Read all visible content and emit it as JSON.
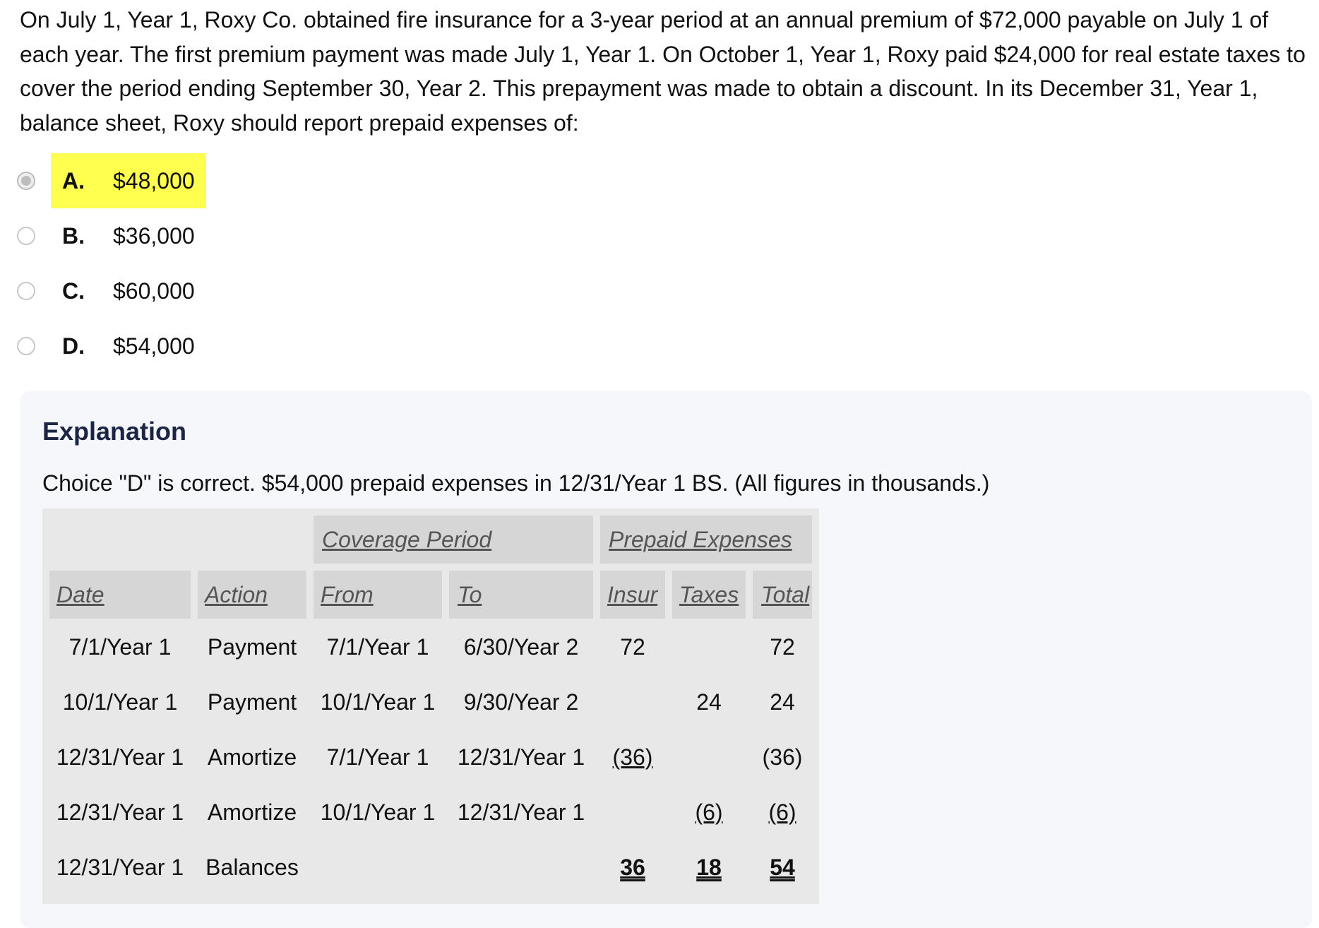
{
  "question": {
    "text": "On July 1, Year 1, Roxy Co. obtained fire insurance for a 3-year period at an annual premium of $72,000 payable on July 1 of each year. The first premium payment was made July 1, Year 1. On October 1, Year 1, Roxy paid $24,000 for real estate taxes to cover the period ending September 30, Year 2. This prepayment was made to obtain a discount. In its December 31, Year 1, balance sheet, Roxy should report prepaid expenses of:"
  },
  "choices": [
    {
      "letter": "A.",
      "value": "$48,000",
      "selected": true,
      "highlighted": true
    },
    {
      "letter": "B.",
      "value": "$36,000",
      "selected": false,
      "highlighted": false
    },
    {
      "letter": "C.",
      "value": "$60,000",
      "selected": false,
      "highlighted": false
    },
    {
      "letter": "D.",
      "value": "$54,000",
      "selected": false,
      "highlighted": false
    }
  ],
  "explanation": {
    "title": "Explanation",
    "text": "Choice \"D\" is correct. $54,000 prepaid expenses in 12/31/Year 1 BS. (All figures in thousands.)",
    "table": {
      "group_headers": {
        "coverage": "Coverage Period",
        "prepaid": "Prepaid Expenses"
      },
      "headers": {
        "date": "Date",
        "action": "Action",
        "from": "From",
        "to": "To",
        "insur": "Insur",
        "taxes": "Taxes",
        "total": "Total"
      },
      "rows": [
        {
          "date": "7/1/Year 1",
          "action": "Payment",
          "from": "7/1/Year 1",
          "to": "6/30/Year 2",
          "insur": "72",
          "taxes": "",
          "total": "72"
        },
        {
          "date": "10/1/Year 1",
          "action": "Payment",
          "from": "10/1/Year 1",
          "to": "9/30/Year 2",
          "insur": "",
          "taxes": "24",
          "total": "24"
        },
        {
          "date": "12/31/Year 1",
          "action": "Amortize",
          "from": "7/1/Year 1",
          "to": "12/31/Year 1",
          "insur": "(36)",
          "taxes": "",
          "total": "(36)"
        },
        {
          "date": "12/31/Year 1",
          "action": "Amortize",
          "from": "10/1/Year 1",
          "to": "12/31/Year 1",
          "insur": "",
          "taxes": "(6)",
          "total": "(6)"
        },
        {
          "date": "12/31/Year 1",
          "action": "Balances",
          "from": "",
          "to": "",
          "insur": "36",
          "taxes": "18",
          "total": "54"
        }
      ]
    }
  }
}
